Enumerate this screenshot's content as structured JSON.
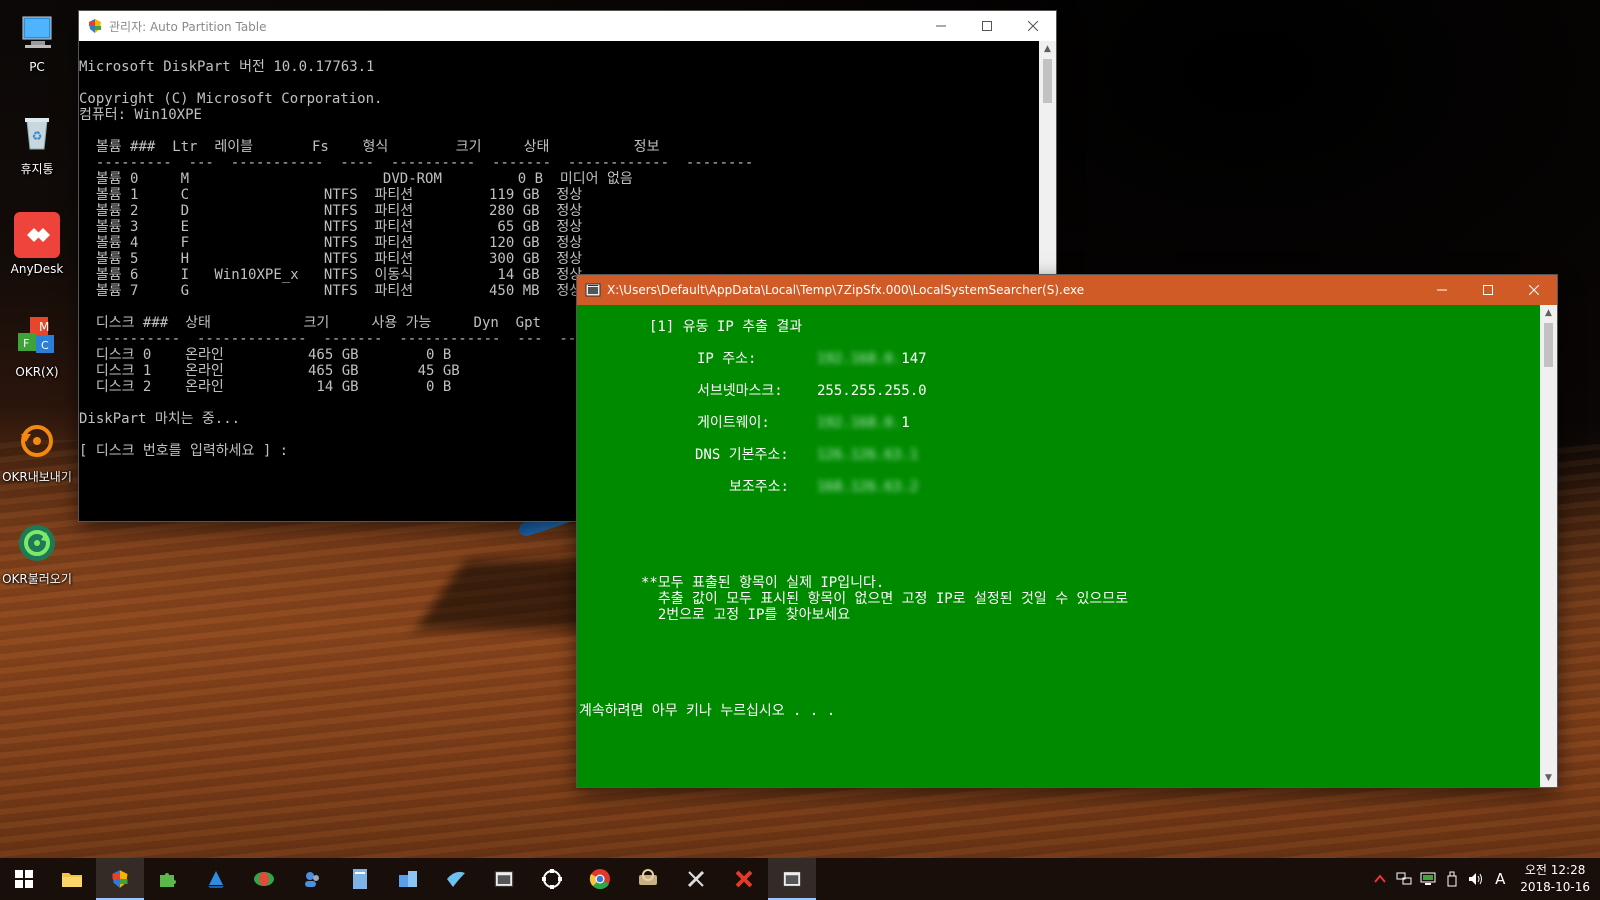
{
  "desktop": {
    "icons": [
      {
        "label": "PC"
      },
      {
        "label": "휴지통"
      },
      {
        "label": "AnyDesk"
      },
      {
        "label": "OKR(X)"
      },
      {
        "label": "OKR내보내기"
      },
      {
        "label": "OKR불러오기"
      }
    ]
  },
  "diskpart_window": {
    "title": "관리자:  Auto Partition Table",
    "lines": [
      "Microsoft DiskPart 버전 10.0.17763.1",
      "",
      "Copyright (C) Microsoft Corporation.",
      "컴퓨터: Win10XPE",
      "",
      "  볼륨 ###  Ltr  레이블       Fs    형식        크기     상태          정보",
      "  ---------  ---  -----------  ----  ----------  -------  ------------  --------",
      "  볼륨 0     M                       DVD-ROM         0 B  미디어 없음",
      "  볼륨 1     C                NTFS  파티션         119 GB  정상",
      "  볼륨 2     D                NTFS  파티션         280 GB  정상",
      "  볼륨 3     E                NTFS  파티션          65 GB  정상",
      "  볼륨 4     F                NTFS  파티션         120 GB  정상",
      "  볼륨 5     H                NTFS  파티션         300 GB  정상",
      "  볼륨 6     I   Win10XPE_x   NTFS  이동식          14 GB  정상",
      "  볼륨 7     G                NTFS  파티션         450 MB  정상",
      "",
      "  디스크 ###  상태           크기     사용 가능     Dyn  Gpt",
      "  ----------  -------------  -------  ------------  ---  ---",
      "  디스크 0    온라인          465 GB        0 B",
      "  디스크 1    온라인          465 GB       45 GB",
      "  디스크 2    온라인           14 GB        0 B",
      "",
      "DiskPart 마치는 중...",
      "",
      "[ 디스크 번호를 입력하세요 ] :"
    ]
  },
  "searcher_window": {
    "title": "X:\\Users\\Default\\AppData\\Local\\Temp\\7ZipSfx.000\\LocalSystemSearcher(S).exe",
    "heading": "[1] 유동 IP 추출 결과",
    "rows": [
      {
        "label": "IP 주소:",
        "hidden": "192.168.0.",
        "value": "147"
      },
      {
        "label": "서브넷마스크:",
        "hidden": "",
        "value": "255.255.255.0"
      },
      {
        "label": "게이트웨이:",
        "hidden": "192.168.0.",
        "value": "1"
      },
      {
        "label": "DNS 기본주소:",
        "hidden": "126.126.63.1",
        "value": ""
      },
      {
        "label": "보조주소:",
        "hidden": "168.126.63.2",
        "value": ""
      }
    ],
    "note_lines": [
      "**모두 표출된 항목이 실제 IP입니다.",
      "  추출 값이 모두 표시된 항목이 없으면 고정 IP로 설정된 것일 수 있으므로",
      "  2번으로 고정 IP를 찾아보세요"
    ],
    "prompt": "계속하려면 아무 키나 누르십시오 . . ."
  },
  "taskbar": {
    "clock_ampm_time": "오전 12:28",
    "clock_date": "2018-10-16",
    "ime": "A"
  },
  "colors": {
    "diskpart_bg": "#000000",
    "searcher_bg": "#008a00",
    "searcher_titlebar": "#d15b27"
  }
}
